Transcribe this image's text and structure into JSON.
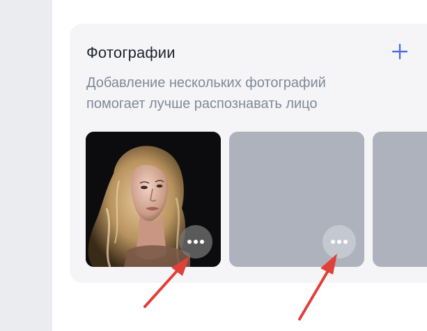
{
  "photos_card": {
    "title": "Фотографии",
    "description_line1": "Добавление нескольких фотографий",
    "description_line2": "помогает лучше распознавать лицо",
    "add_icon": "plus-icon",
    "tiles": [
      {
        "kind": "photo",
        "alt": "portrait photo",
        "menu_icon": "more-dots-icon"
      },
      {
        "kind": "empty",
        "menu_icon": "more-dots-icon"
      },
      {
        "kind": "empty"
      }
    ]
  },
  "colors": {
    "accent": "#4a6ee0",
    "arrow": "#e0403a",
    "card_bg": "#f5f5f7",
    "placeholder": "#aeb2bd",
    "rail": "#ebecef"
  }
}
